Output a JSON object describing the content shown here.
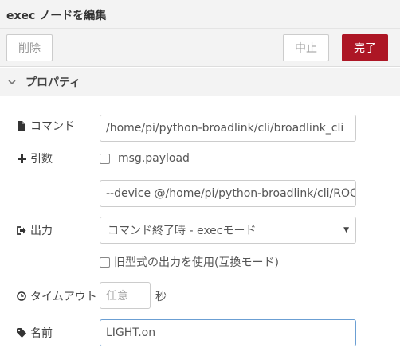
{
  "tray": {
    "title": "exec ノードを編集",
    "delete_label": "削除",
    "cancel_label": "中止",
    "done_label": "完了"
  },
  "section": {
    "title": "プロパティ"
  },
  "fields": {
    "command": {
      "label": "コマンド",
      "value": "/home/pi/python-broadlink/cli/broadlink_cli"
    },
    "args": {
      "label": "引数",
      "append_label": "msg.payload",
      "value": "--device @/home/pi/python-broadlink/cli/ROOM.de"
    },
    "output": {
      "label": "出力",
      "selected": "コマンド終了時 - execモード",
      "legacy_label": "旧型式の出力を使用(互換モード)"
    },
    "timeout": {
      "label": "タイムアウト",
      "placeholder": "任意",
      "unit": "秒"
    },
    "name": {
      "label": "名前",
      "value": "LIGHT.on"
    }
  },
  "colors": {
    "accent": "#ad1625",
    "focus_border": "#6b9fd3"
  }
}
